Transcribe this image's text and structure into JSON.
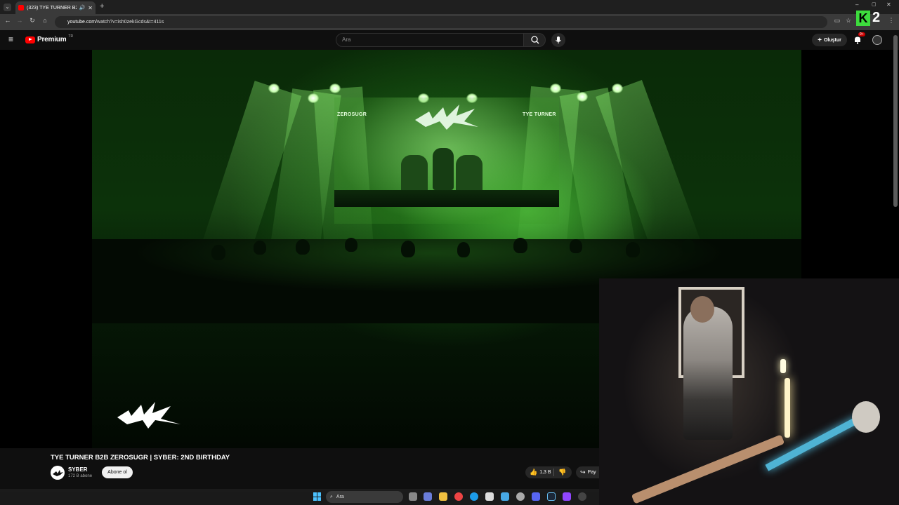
{
  "browser": {
    "tab_title": "(323) TYE TURNER B2B ZE",
    "url_host": "youtube.com",
    "url_path": "/watch?v=ish0zekGcds&t=411s"
  },
  "header": {
    "logo_text": "Premium",
    "logo_region": "TR",
    "search_placeholder": "Ara",
    "create_label": "Oluştur",
    "notification_badge": "9+"
  },
  "video": {
    "stage_left": "ZEROSUGR",
    "stage_right": "TYE TURNER",
    "title": "TYE TURNER B2B ZEROSUGR | SYBER: 2ND BIRTHDAY"
  },
  "channel": {
    "name": "SYBER",
    "subscribers": "172 B abone",
    "subscribe_label": "Abone ol"
  },
  "actions": {
    "like_count": "1,3 B",
    "share_label": "Pay"
  },
  "taskbar": {
    "search_label": "Ara"
  },
  "overlay": {
    "logo_number": "2"
  },
  "colors": {
    "yt_red": "#ff0000",
    "k2_green": "#3ddc3d",
    "stage_green": "#50c83c"
  }
}
